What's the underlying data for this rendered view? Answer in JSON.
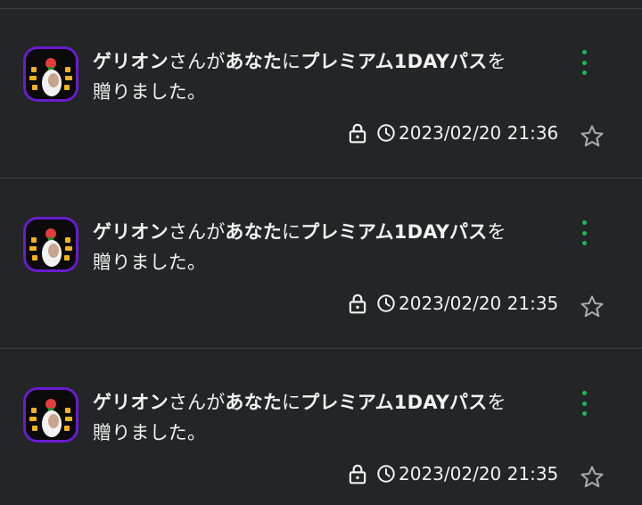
{
  "notifications": [
    {
      "sender": "ゲリオン",
      "text_san": "さんが",
      "text_anata": "あなた",
      "text_ni": "に",
      "item": "プレミアム1DAYパス",
      "text_wo": "を",
      "text_line2": "贈りました。",
      "timestamp": "2023/02/20 21:36"
    },
    {
      "sender": "ゲリオン",
      "text_san": "さんが",
      "text_anata": "あなた",
      "text_ni": "に",
      "item": "プレミアム1DAYパス",
      "text_wo": "を",
      "text_line2": "贈りました。",
      "timestamp": "2023/02/20 21:35"
    },
    {
      "sender": "ゲリオン",
      "text_san": "さんが",
      "text_anata": "あなた",
      "text_ni": "に",
      "item": "プレミアム1DAYパス",
      "text_wo": "を",
      "text_line2": "贈りました。",
      "timestamp": "2023/02/20 21:35"
    }
  ],
  "icons": {
    "more": "more-vertical-icon",
    "lock": "lock-icon",
    "clock": "clock-icon",
    "favorite": "star-outline-icon"
  },
  "colors": {
    "background": "#232526",
    "divider": "#3a3d3f",
    "accent_green": "#1db954",
    "avatar_border": "#6a1bd1",
    "text": "#f2f2f2",
    "icon_gray": "#a8aaab"
  }
}
